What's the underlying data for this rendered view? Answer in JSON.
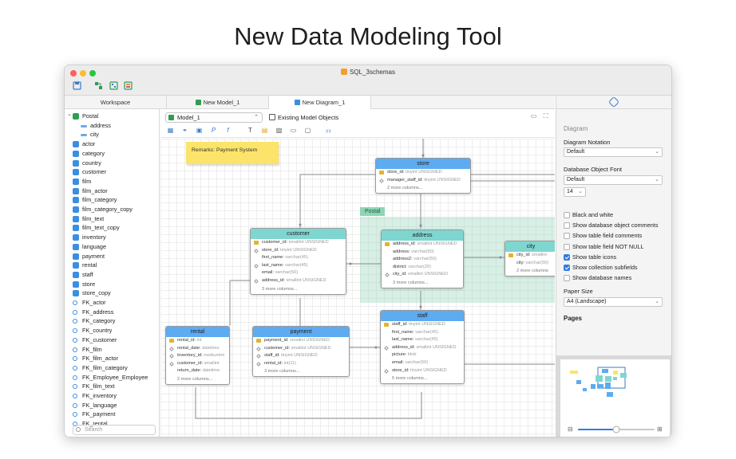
{
  "headline": "New Data Modeling Tool",
  "window": {
    "title": "SQL_3schemas"
  },
  "tabs": {
    "workspace": "Workspace",
    "model": "New Model_1",
    "diagram": "New Diagram_1"
  },
  "sidebar": {
    "items": [
      {
        "label": "Postal",
        "kind": "schema"
      },
      {
        "label": "address",
        "kind": "field"
      },
      {
        "label": "city",
        "kind": "field"
      },
      {
        "label": "actor",
        "kind": "table"
      },
      {
        "label": "category",
        "kind": "table"
      },
      {
        "label": "country",
        "kind": "table"
      },
      {
        "label": "customer",
        "kind": "table"
      },
      {
        "label": "film",
        "kind": "table"
      },
      {
        "label": "film_actor",
        "kind": "table"
      },
      {
        "label": "film_category",
        "kind": "table"
      },
      {
        "label": "film_category_copy",
        "kind": "table"
      },
      {
        "label": "film_text",
        "kind": "table"
      },
      {
        "label": "film_text_copy",
        "kind": "table"
      },
      {
        "label": "inventory",
        "kind": "table"
      },
      {
        "label": "language",
        "kind": "table"
      },
      {
        "label": "payment",
        "kind": "table"
      },
      {
        "label": "rental",
        "kind": "table"
      },
      {
        "label": "staff",
        "kind": "table"
      },
      {
        "label": "store",
        "kind": "table"
      },
      {
        "label": "store_copy",
        "kind": "table"
      },
      {
        "label": "FK_actor",
        "kind": "fk"
      },
      {
        "label": "FK_address",
        "kind": "fk"
      },
      {
        "label": "FK_category",
        "kind": "fk"
      },
      {
        "label": "FK_country",
        "kind": "fk"
      },
      {
        "label": "FK_customer",
        "kind": "fk"
      },
      {
        "label": "FK_film",
        "kind": "fk"
      },
      {
        "label": "FK_film_actor",
        "kind": "fk"
      },
      {
        "label": "FK_film_category",
        "kind": "fk"
      },
      {
        "label": "FK_Employee_Employee",
        "kind": "fk"
      },
      {
        "label": "FK_film_text",
        "kind": "fk"
      },
      {
        "label": "FK_inventory",
        "kind": "fk"
      },
      {
        "label": "FK_language",
        "kind": "fk"
      },
      {
        "label": "FK_payment",
        "kind": "fk"
      },
      {
        "label": "FK_rental",
        "kind": "fk"
      }
    ],
    "search_placeholder": "Search"
  },
  "canvas": {
    "model_select": "Model_1",
    "existing_objects": "Existing Model Objects",
    "note": "Remarks: Payment System",
    "area_label": "Postal",
    "entities": {
      "store": {
        "title": "store",
        "rows": [
          {
            "name": "store_id:",
            "type": "tinyint UNSIGNED",
            "marker": "key"
          },
          {
            "name": "manager_staff_id:",
            "type": "tinyint UNSIGNED",
            "marker": "diamond"
          }
        ],
        "more": "2 more columns..."
      },
      "customer": {
        "title": "customer",
        "rows": [
          {
            "name": "customer_id:",
            "type": "smallint UNSIGNED",
            "marker": "key"
          },
          {
            "name": "store_id:",
            "type": "tinyint UNSIGNED",
            "marker": "diamond"
          },
          {
            "name": "first_name:",
            "type": "varchar(45)",
            "marker": ""
          },
          {
            "name": "last_name:",
            "type": "varchar(45)",
            "marker": "diamond"
          },
          {
            "name": "email:",
            "type": "varchar(50)",
            "marker": ""
          },
          {
            "name": "address_id:",
            "type": "smallint UNSIGNED",
            "marker": "diamond"
          }
        ],
        "more": "3 more columns..."
      },
      "address": {
        "title": "address",
        "rows": [
          {
            "name": "address_id:",
            "type": "smallint UNSIGNED",
            "marker": "key"
          },
          {
            "name": "address:",
            "type": "varchar(50)",
            "marker": ""
          },
          {
            "name": "address2:",
            "type": "varchar(50)",
            "marker": ""
          },
          {
            "name": "district:",
            "type": "varchar(20)",
            "marker": ""
          },
          {
            "name": "city_id:",
            "type": "smallint UNSIGNED",
            "marker": "diamond"
          }
        ],
        "more": "3 more columns..."
      },
      "city": {
        "title": "city",
        "rows": [
          {
            "name": "city_id:",
            "type": "smallint",
            "marker": "key"
          },
          {
            "name": "city:",
            "type": "varchar(50)",
            "marker": ""
          }
        ],
        "more": "2 more columns"
      },
      "rental": {
        "title": "rental",
        "rows": [
          {
            "name": "rental_id:",
            "type": "int",
            "marker": "key"
          },
          {
            "name": "rental_date:",
            "type": "datetime",
            "marker": "diamond"
          },
          {
            "name": "inventory_id:",
            "type": "mediumint",
            "marker": "diamond"
          },
          {
            "name": "customer_id:",
            "type": "smallint",
            "marker": "diamond"
          },
          {
            "name": "return_date:",
            "type": "datetime",
            "marker": ""
          }
        ],
        "more": "2 more columns..."
      },
      "payment": {
        "title": "payment",
        "rows": [
          {
            "name": "payment_id:",
            "type": "smallint UNSIGNED",
            "marker": "key"
          },
          {
            "name": "customer_id:",
            "type": "smallint UNSIGNED",
            "marker": "diamond"
          },
          {
            "name": "staff_id:",
            "type": "tinyint UNSIGNED",
            "marker": "diamond"
          },
          {
            "name": "rental_id:",
            "type": "int(11)",
            "marker": "diamond"
          }
        ],
        "more": "3 more columns..."
      },
      "staff": {
        "title": "staff",
        "rows": [
          {
            "name": "staff_id:",
            "type": "tinyint UNSIGNED",
            "marker": "key"
          },
          {
            "name": "first_name:",
            "type": "varchar(45)",
            "marker": ""
          },
          {
            "name": "last_name:",
            "type": "varchar(45)",
            "marker": ""
          },
          {
            "name": "address_id:",
            "type": "smallint UNSIGNED",
            "marker": "diamond"
          },
          {
            "name": "picture:",
            "type": "blob",
            "marker": ""
          },
          {
            "name": "email:",
            "type": "varchar(50)",
            "marker": ""
          },
          {
            "name": "store_id:",
            "type": "tinyint UNSIGNED",
            "marker": "diamond"
          }
        ],
        "more": "5 more columns..."
      }
    }
  },
  "panel": {
    "section": "Diagram",
    "notation_label": "Diagram Notation",
    "notation_value": "Default",
    "font_label": "Database Object Font",
    "font_value": "Default",
    "font_size": "14",
    "checks": [
      {
        "label": "Black and white",
        "checked": false
      },
      {
        "label": "Show database object comments",
        "checked": false
      },
      {
        "label": "Show table field comments",
        "checked": false
      },
      {
        "label": "Show table field NOT NULL",
        "checked": false
      },
      {
        "label": "Show table icons",
        "checked": true
      },
      {
        "label": "Show collection subfields",
        "checked": true
      },
      {
        "label": "Show database names",
        "checked": false
      }
    ],
    "paper_label": "Paper Size",
    "paper_value": "A4 (Landscape)",
    "pages_label": "Pages",
    "zoom_level": 0.5
  },
  "colors": {
    "accent": "#2f7de1",
    "entity_header": "#5dabf0",
    "entity_header_postal": "#7fd6d0",
    "note": "#fbe469",
    "area": "#8fd5b4"
  }
}
